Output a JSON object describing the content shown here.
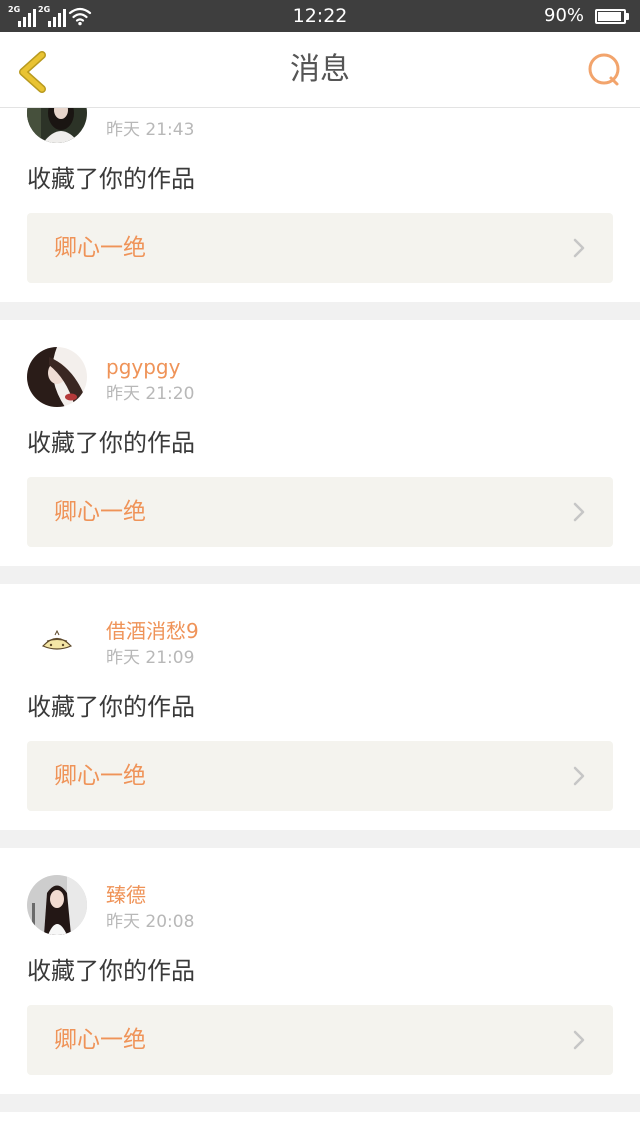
{
  "status_bar": {
    "signal_1": "2G",
    "signal_2": "2G",
    "time": "12:22",
    "battery": "90%"
  },
  "header": {
    "title": "消息"
  },
  "icons": {
    "back": "chevron-left-icon",
    "search": "search-icon",
    "work_arrow": "chevron-right-icon",
    "signal": "signal-icon",
    "wifi": "wifi-icon",
    "battery": "battery-icon"
  },
  "messages": [
    {
      "username": "",
      "time": "昨天 21:43",
      "action": "收藏了你的作品",
      "work_title": "卿心一绝"
    },
    {
      "username": "pgypgy",
      "time": "昨天 21:20",
      "action": "收藏了你的作品",
      "work_title": "卿心一绝"
    },
    {
      "username": "借酒消愁9",
      "time": "昨天 21:09",
      "action": "收藏了你的作品",
      "work_title": "卿心一绝"
    },
    {
      "username": "臻德",
      "time": "昨天 20:08",
      "action": "收藏了你的作品",
      "work_title": "卿心一绝"
    }
  ],
  "colors": {
    "status-bg": "#3e3e3e",
    "accent": "#ef9358",
    "back": "#e9c332",
    "search": "#f2a46c",
    "title": "#555555",
    "time": "#b8b8b8",
    "text": "#3a3a3a",
    "box": "#f4f3ee",
    "sep": "#f1f1f1",
    "chev": "#c6c6c6"
  }
}
